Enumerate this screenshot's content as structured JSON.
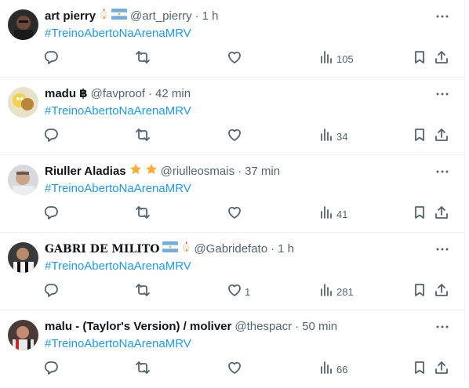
{
  "tweets": [
    {
      "name": "art pierry",
      "handle": "@art_pierry",
      "time": "1 h",
      "hashtag": "#TreinoAbertoNaArenaMRV",
      "likes": "",
      "views": "105",
      "badges": [
        "rooster-emoji",
        "argentina-flag-emoji"
      ]
    },
    {
      "name": "madu ฿",
      "handle": "@favproof",
      "time": "42 min",
      "hashtag": "#TreinoAbertoNaArenaMRV",
      "likes": "",
      "views": "34",
      "badges": []
    },
    {
      "name": "Riuller Aladias",
      "handle": "@riulleosmais",
      "time": "37 min",
      "hashtag": "#TreinoAbertoNaArenaMRV",
      "likes": "",
      "views": "41",
      "badges": [
        "star-emoji",
        "star-emoji"
      ]
    },
    {
      "name": "GABRI DE MILITO",
      "handle": "@Gabridefato",
      "time": "1 h",
      "hashtag": "#TreinoAbertoNaArenaMRV",
      "likes": "1",
      "views": "281",
      "badges": [
        "argentina-flag-emoji",
        "rooster-emoji"
      ]
    },
    {
      "name": "malu - (Taylor's Version) / moliver",
      "handle": "@thespacr",
      "time": "50 min",
      "hashtag": "#TreinoAbertoNaArenaMRV",
      "likes": "",
      "views": "66",
      "badges": []
    }
  ],
  "separator": "·",
  "icons": [
    "more-icon",
    "reply-icon",
    "retweet-icon",
    "like-icon",
    "views-icon",
    "bookmark-icon",
    "share-icon"
  ],
  "colors": {
    "link": "#1d9bf0",
    "muted": "#536471",
    "text": "#0f1419"
  }
}
